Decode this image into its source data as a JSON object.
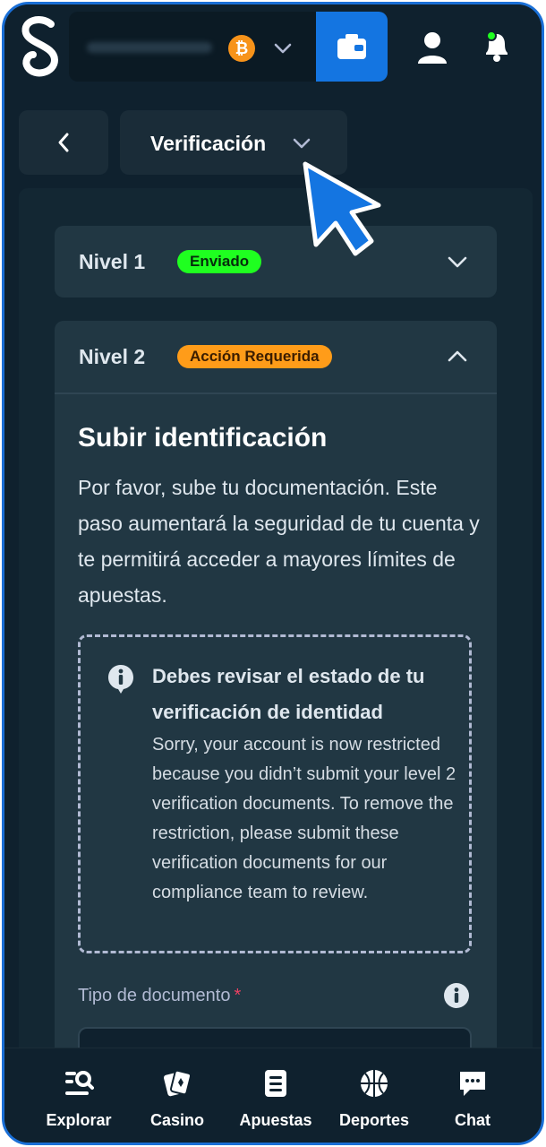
{
  "header": {
    "logo_alt": "S",
    "currency_icon": "bitcoin-icon",
    "wallet_icon": "wallet-icon",
    "user_icon": "user-icon",
    "bell_icon": "bell-icon",
    "accent_color": "#1475e1"
  },
  "nav": {
    "back_icon": "chevron-left-icon",
    "section_label": "Verificación"
  },
  "levels": [
    {
      "title": "Nivel 1",
      "badge": "Enviado",
      "badge_color": "#1fff20",
      "expanded": false
    },
    {
      "title": "Nivel 2",
      "badge": "Acción Requerida",
      "badge_color": "#ff9c19",
      "expanded": true
    }
  ],
  "upload": {
    "title": "Subir identificación",
    "description": "Por favor, sube tu documentación. Este paso aumentará la seguridad de tu cuenta y te permitirá acceder a mayores límites de apuestas.",
    "notice_title": "Debes revisar el estado de tu verificación de identidad",
    "notice_body": "Sorry, your account is now restricted because you didn’t submit your level 2 verification documents. To remove the restriction, please submit these verification documents for our compliance team to review.",
    "doc_type_label": "Tipo de documento",
    "required_mark": "*"
  },
  "bottom_nav": [
    {
      "label": "Explorar",
      "icon": "explore-icon"
    },
    {
      "label": "Casino",
      "icon": "casino-cards-icon"
    },
    {
      "label": "Apuestas",
      "icon": "bets-list-icon"
    },
    {
      "label": "Deportes",
      "icon": "basketball-icon"
    },
    {
      "label": "Chat",
      "icon": "chat-icon"
    }
  ]
}
